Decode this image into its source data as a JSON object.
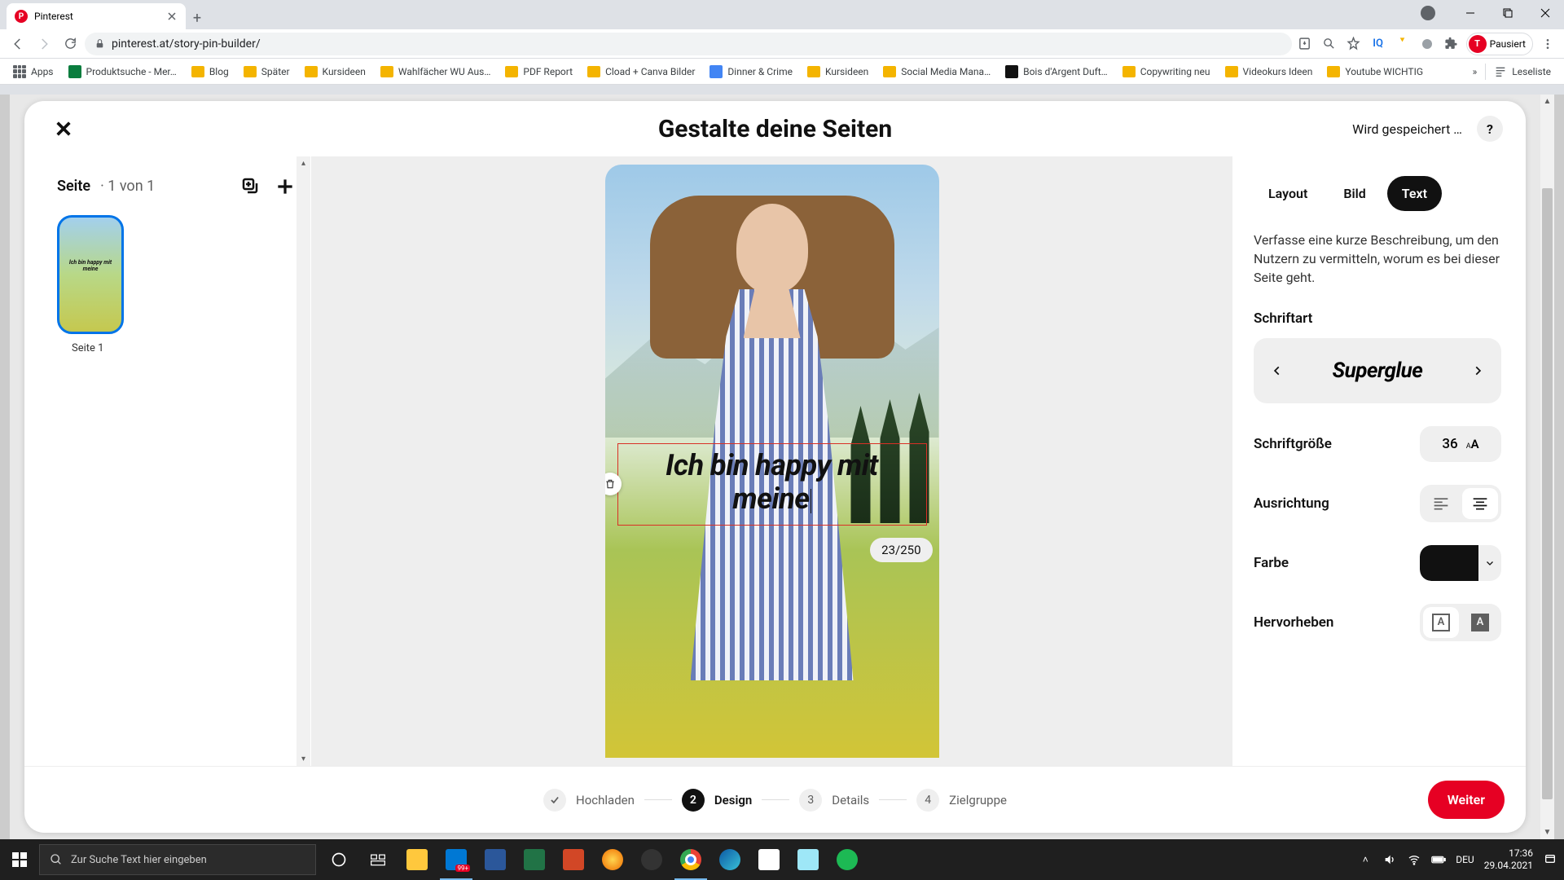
{
  "browser": {
    "tab_title": "Pinterest",
    "url": "pinterest.at/story-pin-builder/",
    "profile_status": "Pausiert",
    "bookmarks": [
      "Apps",
      "Produktsuche - Mer…",
      "Blog",
      "Später",
      "Kursideen",
      "Wahlfächer WU Aus…",
      "PDF Report",
      "Cload + Canva Bilder",
      "Dinner & Crime",
      "Kursideen",
      "Social Media Mana…",
      "Bois d'Argent Duft…",
      "Copywriting neu",
      "Videokurs Ideen",
      "Youtube WICHTIG"
    ],
    "reading_list": "Leseliste"
  },
  "header": {
    "title": "Gestalte deine Seiten",
    "saving": "Wird gespeichert …"
  },
  "left": {
    "page_label": "Seite",
    "page_count": "1 von 1",
    "thumb_label": "Seite 1"
  },
  "canvas": {
    "text_line1": "Ich bin happy mit",
    "text_line2": "meine",
    "char_count": "23/250"
  },
  "right": {
    "tabs": {
      "layout": "Layout",
      "image": "Bild",
      "text": "Text"
    },
    "description": "Verfasse eine kurze Beschreibung, um den Nutzern zu vermitteln, worum es bei dieser Seite geht.",
    "font_label": "Schriftart",
    "font_name": "Superglue",
    "size_label": "Schriftgröße",
    "size_value": "36",
    "align_label": "Ausrichtung",
    "color_label": "Farbe",
    "color_value": "#111111",
    "highlight_label": "Hervorheben"
  },
  "footer": {
    "steps": [
      "Hochladen",
      "Design",
      "Details",
      "Zielgruppe"
    ],
    "next": "Weiter"
  },
  "taskbar": {
    "search_placeholder": "Zur Suche Text hier eingeben",
    "lang": "DEU",
    "time": "17:36",
    "date": "29.04.2021"
  }
}
